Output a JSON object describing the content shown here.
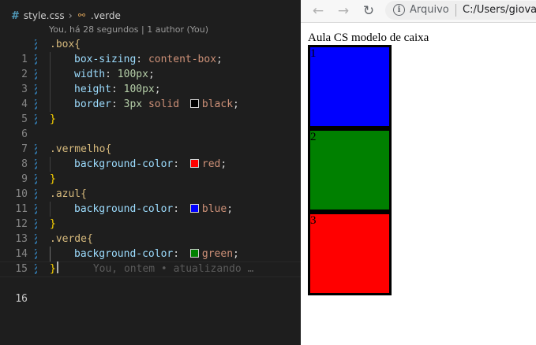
{
  "editor": {
    "breadcrumb": {
      "file": "style.css",
      "symbol": ".verde"
    },
    "blame": "You, há 28 segundos | 1 author (You)",
    "ghost": "You, ontem • atualizando …",
    "line_numbers": [
      "1",
      "2",
      "3",
      "4",
      "5",
      "6",
      "7",
      "8",
      "9",
      "10",
      "11",
      "12",
      "13",
      "14",
      "15",
      "16"
    ],
    "code": {
      "box_sel": ".box{",
      "box_sizing_prop": "box-sizing",
      "box_sizing_val": "content-box",
      "width_prop": "width",
      "width_val": "100px",
      "height_prop": "height",
      "height_val": "100px",
      "border_prop": "border",
      "border_width": "3px",
      "border_style": "solid",
      "border_color": "black",
      "close": "}",
      "vermelho_sel": ".vermelho{",
      "azul_sel": ".azul{",
      "verde_sel": ".verde{",
      "bg_prop": "background-color",
      "red_val": "red",
      "blue_val": "blue",
      "green_val": "green"
    },
    "colors": {
      "black": "#000000",
      "red": "#ff0000",
      "blue": "#0000ff",
      "green": "#008000"
    }
  },
  "browser": {
    "protocol": "Arquivo",
    "url": "C:/Users/giova",
    "page": {
      "heading": "Aula CS modelo de caixa",
      "boxes": [
        {
          "label": "1",
          "color": "#0000ff"
        },
        {
          "label": "2",
          "color": "#008000"
        },
        {
          "label": "3",
          "color": "#ff0000"
        }
      ]
    }
  }
}
